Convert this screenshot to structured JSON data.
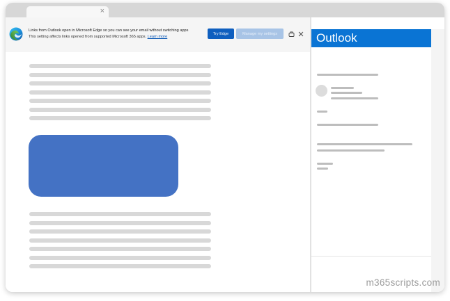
{
  "tab": {
    "close_glyph": "×"
  },
  "infobar": {
    "message": "Links from Outlook open in Microsoft Edge so you can see your email without switching apps",
    "detail": "This setting affects links opened from supported Microsoft 365 apps.",
    "learn_more": "Learn more",
    "try_edge_label": "Try Edge",
    "manage_label": "Manage my settings",
    "pin_icon": "pin-icon",
    "close_icon": "close-icon"
  },
  "pane": {
    "title": "Outlook",
    "header_color": "#0a74d4"
  },
  "accent": {
    "button_blue": "#0f5fbf",
    "block_blue": "#4472c4"
  },
  "watermark": "m365scripts.com"
}
